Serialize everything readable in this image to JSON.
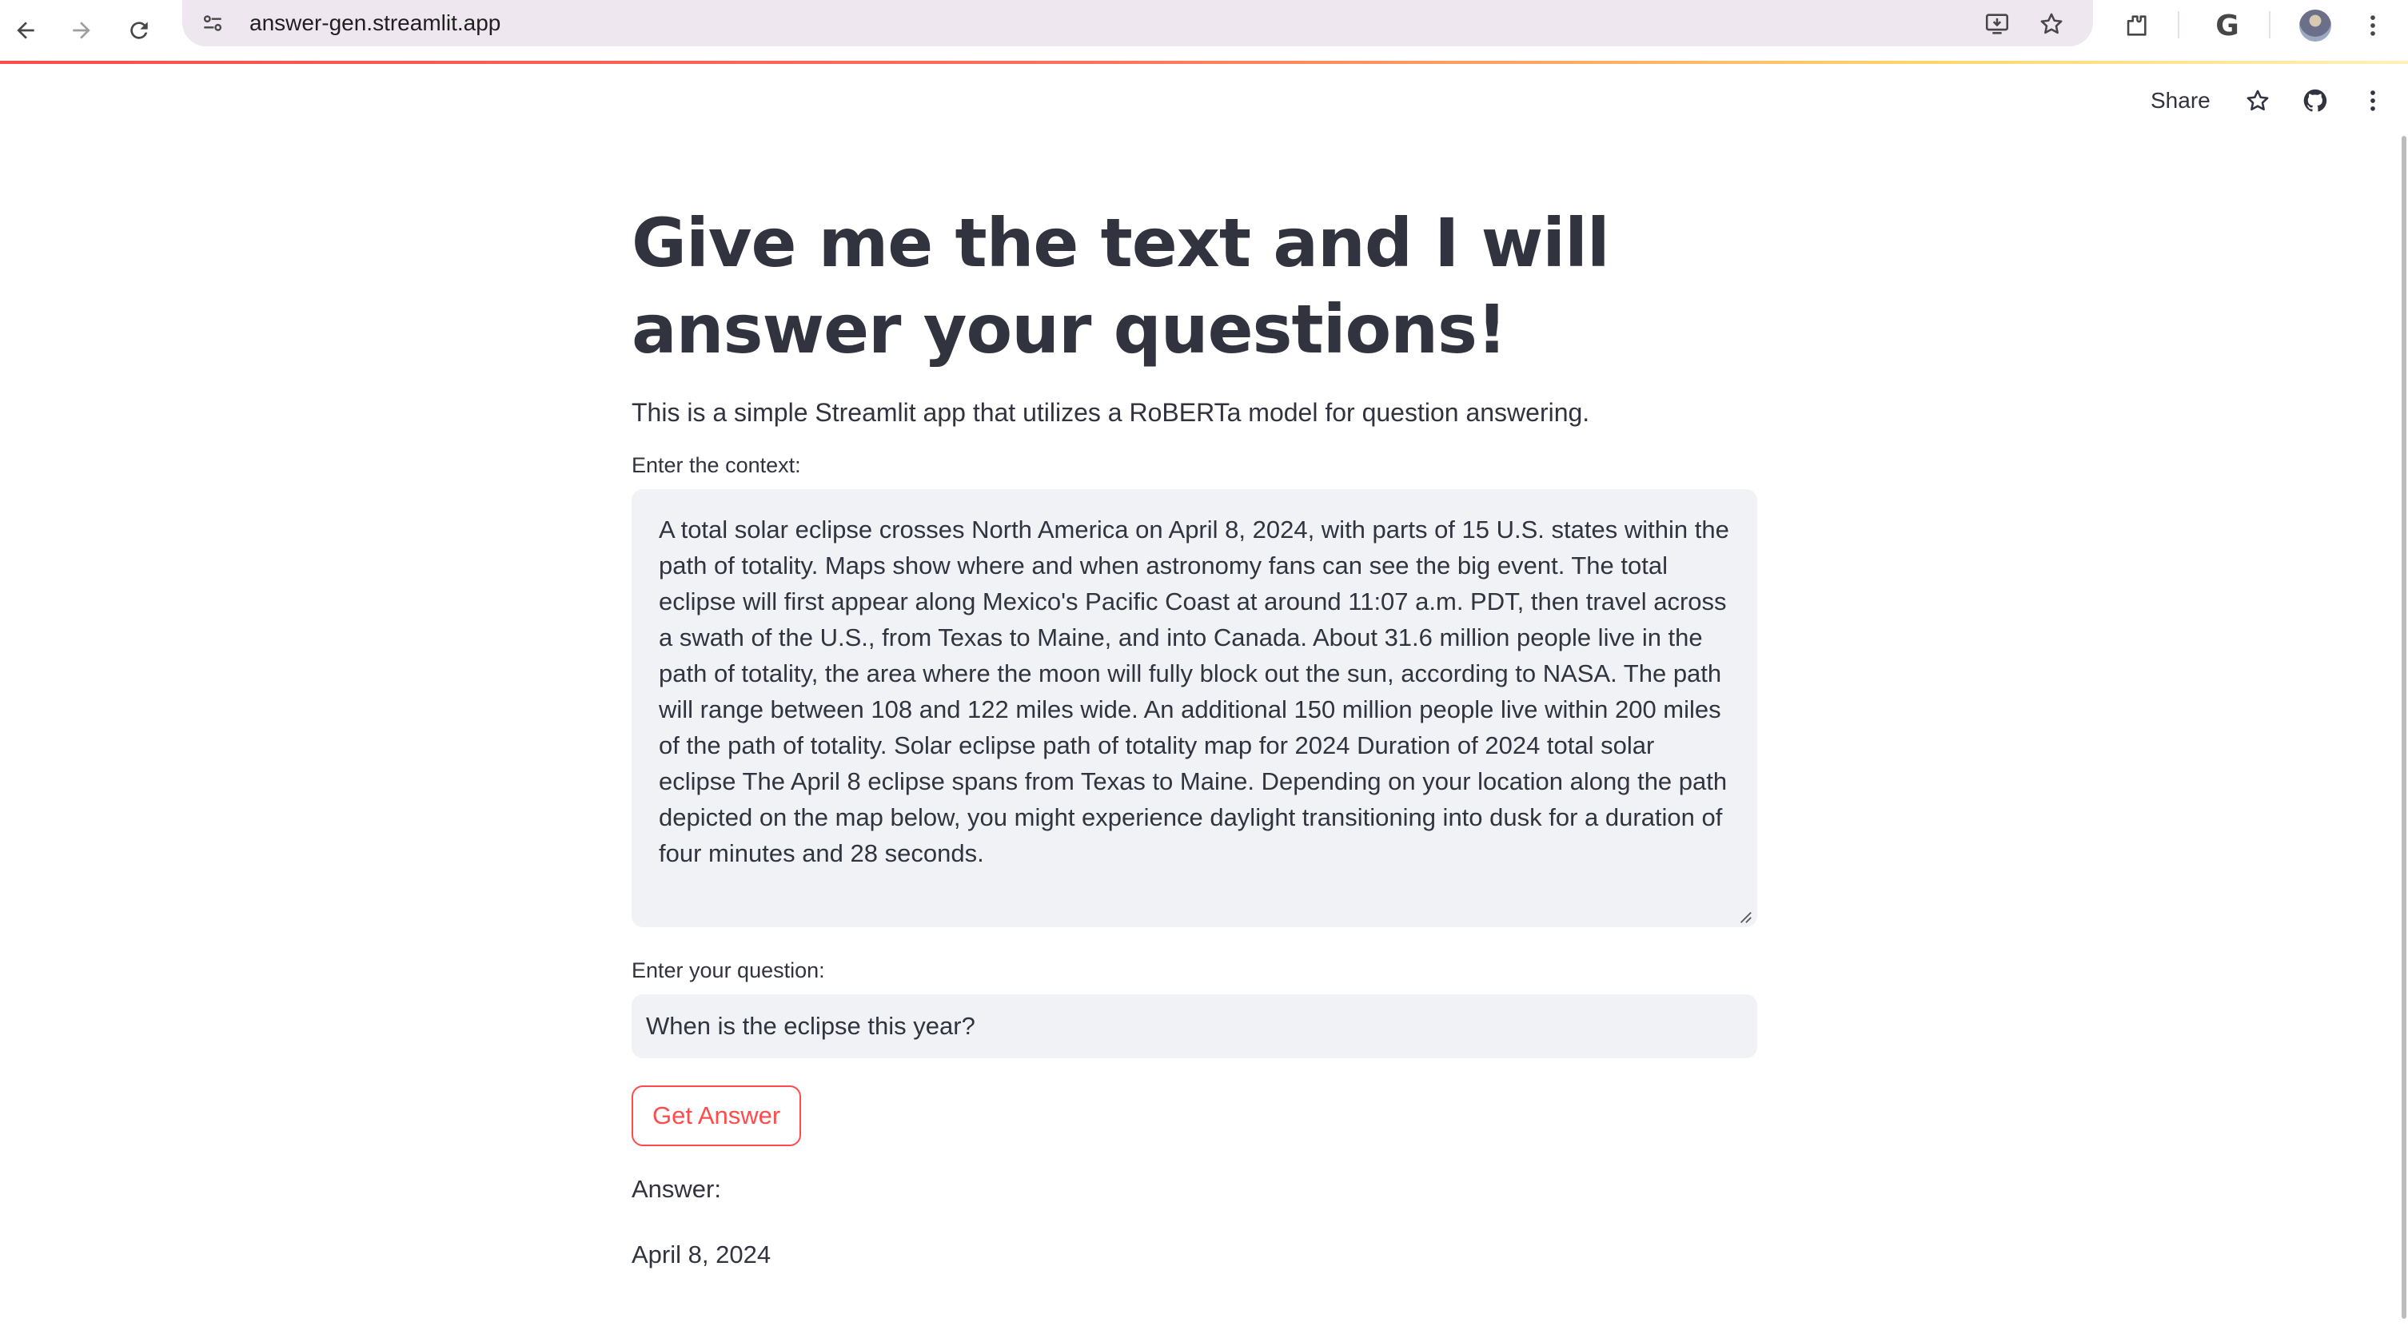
{
  "browser": {
    "url": "answer-gen.streamlit.app",
    "back_icon": "back-arrow-icon",
    "forward_icon": "forward-arrow-icon",
    "reload_icon": "reload-icon",
    "site_info_icon": "tune-icon",
    "install_icon": "install-app-icon",
    "bookmark_icon": "star-icon",
    "extensions_icon": "puzzle-icon",
    "google_label": "G",
    "profile_icon": "avatar",
    "menu_icon": "kebab-icon"
  },
  "streamlit_header": {
    "share_label": "Share",
    "star_icon": "star-icon",
    "github_icon": "github-icon",
    "menu_icon": "kebab-icon"
  },
  "main": {
    "title": "Give me the text and I will answer your questions!",
    "subtitle": "This is a simple Streamlit app that utilizes a RoBERTa model for question answering.",
    "context_label": "Enter the context:",
    "context_value": "A total solar eclipse crosses North America on April 8, 2024, with parts of 15 U.S. states within the path of totality. Maps show where and when astronomy fans can see the big event. The total eclipse will first appear along Mexico's Pacific Coast at around 11:07 a.m. PDT, then travel across a swath of the U.S., from Texas to Maine, and into Canada. About 31.6 million people live in the path of totality, the area where the moon will fully block out the sun, according to NASA. The path will range between 108 and 122 miles wide. An additional 150 million people live within 200 miles of the path of totality. Solar eclipse path of totality map for 2024 Duration of 2024 total solar eclipse The April 8 eclipse spans from Texas to Maine. Depending on your location along the path depicted on the map below, you might experience daylight transitioning into dusk for a duration of four minutes and 28 seconds.",
    "question_label": "Enter your question:",
    "question_value": "When is the eclipse this year?",
    "button_label": "Get Answer",
    "answer_label": "Answer:",
    "answer_value": "April 8, 2024"
  },
  "colors": {
    "accent": "#ff4b4b",
    "text": "#31333f",
    "input_bg": "#f0f2f6",
    "omnibox_bg": "#efe7f0"
  }
}
